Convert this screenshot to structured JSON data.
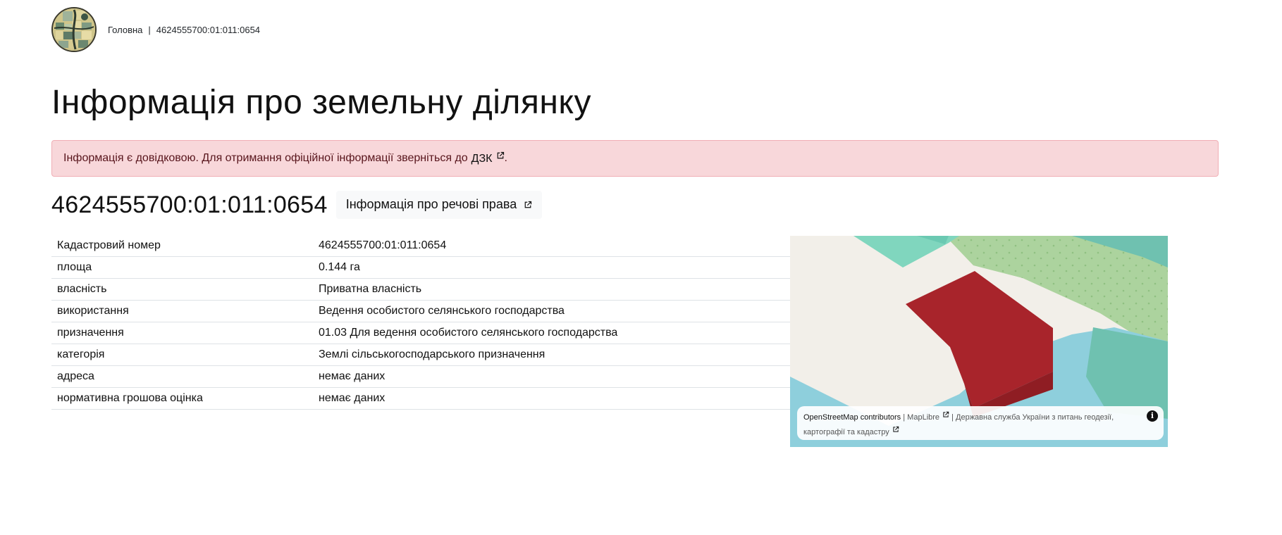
{
  "breadcrumb": {
    "home": "Головна",
    "separator": "|",
    "current": "4624555700:01:011:0654"
  },
  "page_title": "Інформація про земельну ділянку",
  "alert": {
    "text": "Інформація є довідковою. Для отримання офіційної інформації зверніться до",
    "link": "ДЗК",
    "suffix": ".",
    "color": "#f8d7da"
  },
  "parcel": {
    "id": "4624555700:01:011:0654",
    "rights_button": "Інформація про речові права"
  },
  "table": [
    {
      "key": "Кадастровий номер",
      "value": "4624555700:01:011:0654"
    },
    {
      "key": "площа",
      "value": "0.144 га"
    },
    {
      "key": "власність",
      "value": "Приватна власність"
    },
    {
      "key": "використання",
      "value": "Ведення особистого селянського господарства"
    },
    {
      "key": "призначення",
      "value": "01.03 Для ведення особистого селянського господарства"
    },
    {
      "key": "категорія",
      "value": "Землі сільськогосподарського призначення"
    },
    {
      "key": "адреса",
      "value": "немає даних"
    },
    {
      "key": "нормативна грошова оцінка",
      "value": "немає даних"
    }
  ],
  "map": {
    "parcel_color": "#a8242b",
    "attribution": {
      "osm": "OpenStreetMap contributors",
      "sep1": "|",
      "maplibre": "MapLibre",
      "sep2": "|",
      "agency": "Державна служба України з питань геодезії, картографії та кадастру"
    },
    "info_icon": "info-icon"
  }
}
